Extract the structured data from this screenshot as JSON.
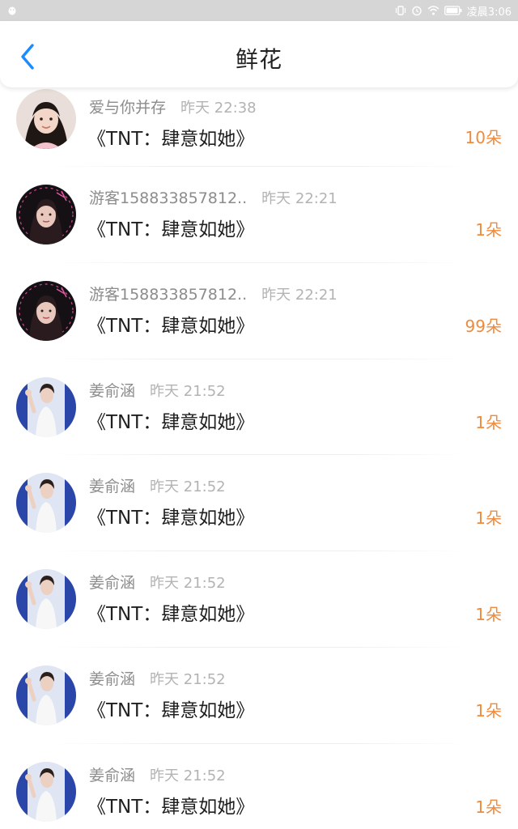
{
  "status_bar": {
    "time": "凌晨3:06",
    "icons": [
      "vibrate-icon",
      "alarm-icon",
      "wifi-icon",
      "battery-icon"
    ]
  },
  "header": {
    "title": "鲜花",
    "back_icon": "chevron-left-icon",
    "back_color": "#1a8cff"
  },
  "colors": {
    "count": "#f08a3c",
    "username": "#8c8c8c",
    "timestamp": "#b3b3b3"
  },
  "records": [
    {
      "user": "爱与你并存",
      "time": "昨天 22:38",
      "book": "《TNT：肆意如她》",
      "count": "10朵",
      "avatar": "girl-dark-hair"
    },
    {
      "user": "游客158833857812..",
      "time": "昨天 22:21",
      "book": "《TNT：肆意如她》",
      "count": "1朵",
      "avatar": "woman-dark-frame"
    },
    {
      "user": "游客158833857812..",
      "time": "昨天 22:21",
      "book": "《TNT：肆意如她》",
      "count": "99朵",
      "avatar": "woman-dark-frame"
    },
    {
      "user": "姜俞涵",
      "time": "昨天 21:52",
      "book": "《TNT：肆意如她》",
      "count": "1朵",
      "avatar": "woman-waving"
    },
    {
      "user": "姜俞涵",
      "time": "昨天 21:52",
      "book": "《TNT：肆意如她》",
      "count": "1朵",
      "avatar": "woman-waving"
    },
    {
      "user": "姜俞涵",
      "time": "昨天 21:52",
      "book": "《TNT：肆意如她》",
      "count": "1朵",
      "avatar": "woman-waving"
    },
    {
      "user": "姜俞涵",
      "time": "昨天 21:52",
      "book": "《TNT：肆意如她》",
      "count": "1朵",
      "avatar": "woman-waving"
    },
    {
      "user": "姜俞涵",
      "time": "昨天 21:52",
      "book": "《TNT：肆意如她》",
      "count": "1朵",
      "avatar": "woman-waving"
    }
  ]
}
